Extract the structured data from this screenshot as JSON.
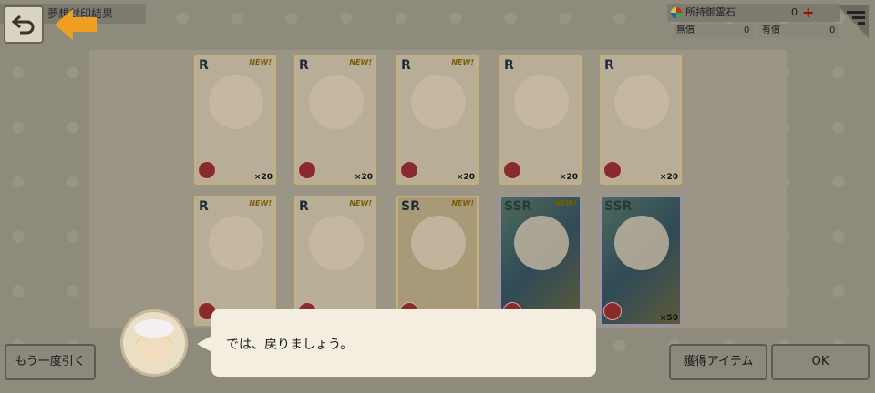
{
  "header": {
    "title": "夢想封印結果"
  },
  "stone": {
    "label": "所持御霊石",
    "count": "0",
    "free_label": "無償",
    "free_count": "0",
    "paid_label": "有償",
    "paid_count": "0"
  },
  "cards": [
    {
      "rarity": "R",
      "new": "NEW!",
      "count": "×20"
    },
    {
      "rarity": "R",
      "new": "NEW!",
      "count": "×20"
    },
    {
      "rarity": "R",
      "new": "NEW!",
      "count": "×20"
    },
    {
      "rarity": "R",
      "new": "",
      "count": "×20"
    },
    {
      "rarity": "R",
      "new": "",
      "count": "×20"
    },
    {
      "rarity": "R",
      "new": "NEW!",
      "count": ""
    },
    {
      "rarity": "R",
      "new": "NEW!",
      "count": ""
    },
    {
      "rarity": "SR",
      "new": "NEW!",
      "count": ""
    },
    {
      "rarity": "SSR",
      "new": "NEW!",
      "count": ""
    },
    {
      "rarity": "SSR",
      "new": "",
      "count": "×50"
    }
  ],
  "dialog": {
    "text": "では、戻りましょう。"
  },
  "buttons": {
    "redraw": "もう一度引く",
    "items": "獲得アイテム",
    "ok": "OK"
  },
  "colors": {
    "accent_arrow": "#f0a020"
  }
}
